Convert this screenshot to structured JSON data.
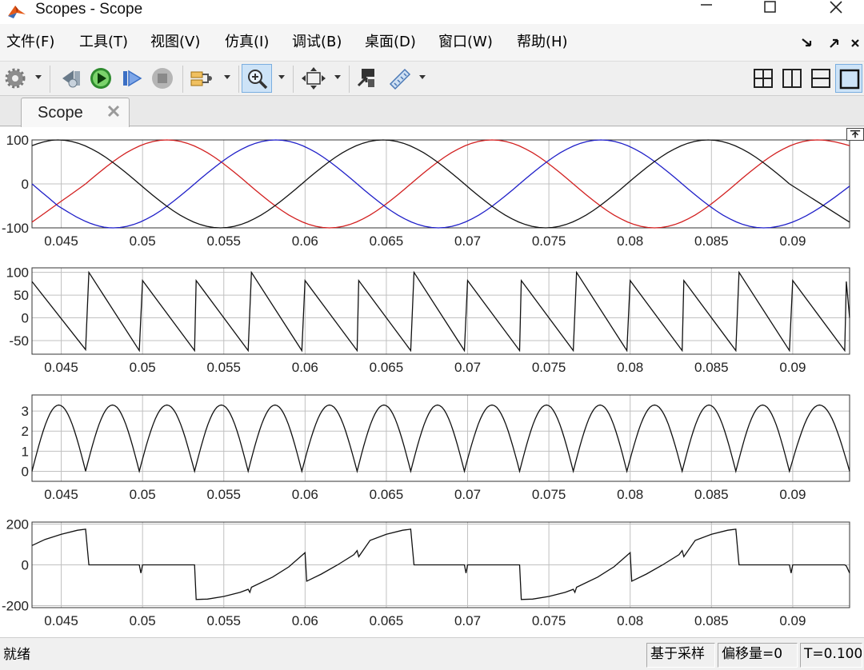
{
  "window": {
    "title": "Scopes - Scope"
  },
  "menu": [
    "文件(F)",
    "工具(T)",
    "视图(V)",
    "仿真(I)",
    "调试(B)",
    "桌面(D)",
    "窗口(W)",
    "帮助(H)"
  ],
  "toolbar": {
    "buttons": [
      "settings-icon",
      "step-back-icon",
      "run-icon",
      "step-forward-icon",
      "stop-icon",
      "triggers-icon",
      "zoom-in-icon",
      "fit-axes-icon",
      "highlight-block-icon",
      "measurements-icon"
    ],
    "layouts": [
      "layout-2x2-icon",
      "layout-columns-icon",
      "layout-rows-icon",
      "layout-single-icon"
    ]
  },
  "tab": {
    "label": "Scope"
  },
  "status": {
    "ready": "就绪",
    "sample_mode": "基于采样",
    "offset": "偏移量=0",
    "time": "T=0.100"
  },
  "colors": {
    "phase_a": "#d21f1f",
    "phase_b": "#1f1fc8",
    "phase_c": "#111111",
    "grid": "#c0c0c0"
  },
  "chart_data": [
    {
      "type": "line",
      "xlim": [
        0.0432,
        0.0935
      ],
      "ylim": [
        -100,
        100
      ],
      "yticks": [
        "100",
        "0",
        "-100"
      ],
      "xticks": [
        "0.045",
        "0.05",
        "0.055",
        "0.06",
        "0.065",
        "0.07",
        "0.075",
        "0.08",
        "0.085",
        "0.09"
      ],
      "grid": true,
      "series": [
        {
          "color": "#d21f1f",
          "x": [
            0.0432,
            0.0465,
            0.0515,
            0.0565,
            0.0615,
            0.0665,
            0.0715,
            0.0765,
            0.0815,
            0.0865,
            0.0915,
            0.0935
          ],
          "y": [
            -87,
            0,
            100,
            0,
            -100,
            0,
            100,
            0,
            -100,
            0,
            100,
            87
          ]
        },
        {
          "color": "#1f1fc8",
          "x": [
            0.0432,
            0.0448,
            0.0482,
            0.0532,
            0.0582,
            0.0632,
            0.0682,
            0.0732,
            0.0782,
            0.0832,
            0.0882,
            0.0935
          ],
          "y": [
            0,
            -50,
            -100,
            0,
            100,
            0,
            -100,
            0,
            100,
            0,
            -100,
            -5
          ]
        },
        {
          "color": "#111111",
          "x": [
            0.0432,
            0.0448,
            0.0498,
            0.0548,
            0.0598,
            0.0648,
            0.0698,
            0.0748,
            0.0798,
            0.0848,
            0.0898,
            0.0935
          ],
          "y": [
            87,
            100,
            0,
            -100,
            0,
            100,
            0,
            -100,
            0,
            100,
            0,
            -87
          ]
        }
      ]
    },
    {
      "type": "line",
      "xlim": [
        0.0432,
        0.0935
      ],
      "ylim": [
        -80,
        110
      ],
      "yticks": [
        "100",
        "50",
        "0",
        "-50"
      ],
      "xticks": [
        "0.045",
        "0.05",
        "0.055",
        "0.06",
        "0.065",
        "0.07",
        "0.075",
        "0.08",
        "0.085",
        "0.09"
      ],
      "grid": true,
      "series": [
        {
          "color": "#111111",
          "x": [
            0.0432,
            0.0465,
            0.0467,
            0.0498,
            0.05,
            0.0532,
            0.0533,
            0.0565,
            0.0567,
            0.0598,
            0.06,
            0.0632,
            0.0633,
            0.0665,
            0.0667,
            0.0698,
            0.07,
            0.0732,
            0.0733,
            0.0765,
            0.0767,
            0.0798,
            0.08,
            0.0832,
            0.0833,
            0.0865,
            0.0867,
            0.0898,
            0.09,
            0.0932,
            0.0933,
            0.0935
          ],
          "y": [
            80,
            -70,
            100,
            -72,
            82,
            -72,
            82,
            -72,
            100,
            -72,
            82,
            -72,
            82,
            -72,
            100,
            -72,
            82,
            -72,
            82,
            -72,
            100,
            -72,
            82,
            -72,
            82,
            -72,
            100,
            -72,
            82,
            -72,
            80,
            0
          ]
        }
      ]
    },
    {
      "type": "line",
      "xlim": [
        0.0432,
        0.0935
      ],
      "ylim": [
        -0.5,
        3.8
      ],
      "yticks": [
        "3",
        "2",
        "1",
        "0"
      ],
      "xticks": [
        "0.045",
        "0.05",
        "0.055",
        "0.06",
        "0.065",
        "0.07",
        "0.075",
        "0.08",
        "0.085",
        "0.09"
      ],
      "grid": true,
      "series": [
        {
          "color": "#111111",
          "rectified_sine": {
            "amplitude": 3.3,
            "zeros": [
              0.0432,
              0.0465,
              0.0498,
              0.0532,
              0.0565,
              0.0598,
              0.0632,
              0.0665,
              0.0698,
              0.0732,
              0.0765,
              0.0798,
              0.0832,
              0.0865,
              0.0898,
              0.0935
            ]
          }
        }
      ]
    },
    {
      "type": "line",
      "xlim": [
        0.0432,
        0.0935
      ],
      "ylim": [
        -210,
        210
      ],
      "yticks": [
        "200",
        "0",
        "-200"
      ],
      "xticks": [
        "0.045",
        "0.05",
        "0.055",
        "0.06",
        "0.065",
        "0.07",
        "0.075",
        "0.08",
        "0.085",
        "0.09"
      ],
      "grid": true,
      "series": [
        {
          "color": "#111111",
          "x": [
            0.0432,
            0.044,
            0.045,
            0.046,
            0.0465,
            0.0467,
            0.0498,
            0.0499,
            0.05,
            0.0501,
            0.0532,
            0.0533,
            0.054,
            0.055,
            0.056,
            0.0565,
            0.0566,
            0.0567,
            0.058,
            0.059,
            0.06,
            0.0601,
            0.061,
            0.062,
            0.063,
            0.0632,
            0.0633,
            0.064,
            0.065,
            0.066,
            0.0665,
            0.0667,
            0.0698,
            0.0699,
            0.07,
            0.0701,
            0.0732,
            0.0733,
            0.074,
            0.075,
            0.076,
            0.0765,
            0.0766,
            0.0767,
            0.078,
            0.079,
            0.08,
            0.0801,
            0.081,
            0.082,
            0.083,
            0.0832,
            0.0833,
            0.084,
            0.085,
            0.086,
            0.0865,
            0.0867,
            0.0898,
            0.0899,
            0.09,
            0.0901,
            0.0932,
            0.0933,
            0.0935
          ],
          "y": [
            95,
            125,
            150,
            170,
            175,
            0,
            0,
            -40,
            0,
            0,
            0,
            -170,
            -168,
            -155,
            -135,
            -120,
            -135,
            -110,
            -60,
            -10,
            60,
            -80,
            -45,
            0,
            50,
            70,
            40,
            120,
            150,
            170,
            175,
            0,
            0,
            -40,
            0,
            0,
            0,
            -170,
            -168,
            -155,
            -135,
            -120,
            -135,
            -110,
            -60,
            -10,
            60,
            -80,
            -45,
            0,
            50,
            70,
            40,
            120,
            150,
            170,
            175,
            0,
            0,
            -40,
            0,
            0,
            0,
            -5,
            -40
          ]
        }
      ]
    }
  ]
}
